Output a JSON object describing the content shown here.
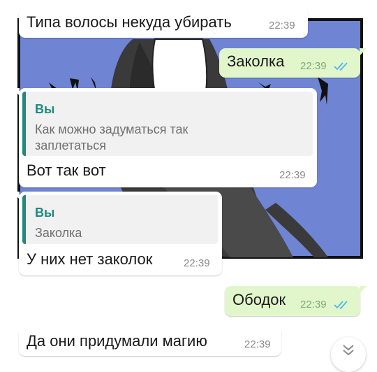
{
  "wallpaper": {
    "background_color": "#6f84d2",
    "description_icon": "manga-character-wallpaper"
  },
  "messages": [
    {
      "direction": "incoming",
      "text": "Типа волосы некуда убирать",
      "time": "22:39"
    },
    {
      "direction": "outgoing",
      "text": "Заколка",
      "time": "22:39",
      "status_icon": "double-check-read-icon"
    },
    {
      "direction": "incoming",
      "quote": {
        "author": "Вы",
        "line1": "Как можно задуматься так",
        "line2": "заплетаться"
      },
      "text": "Вот так вот",
      "time": "22:39"
    },
    {
      "direction": "incoming",
      "quote": {
        "author": "Вы",
        "line1": "Заколка"
      },
      "text": "У них нет заколок",
      "time": "22:39"
    },
    {
      "direction": "outgoing",
      "text": "Ободок",
      "time": "22:39",
      "status_icon": "double-check-read-icon"
    },
    {
      "direction": "incoming",
      "text": "Да они придумали магию",
      "time": "22:39"
    }
  ],
  "scroll_button": {
    "icon": "double-chevron-down-icon"
  },
  "colors": {
    "outgoing_bubble": "#e1f7cb",
    "incoming_bubble": "#ffffff",
    "quote_accent": "#1d8a7e",
    "read_ticks": "#4fb6ec"
  }
}
